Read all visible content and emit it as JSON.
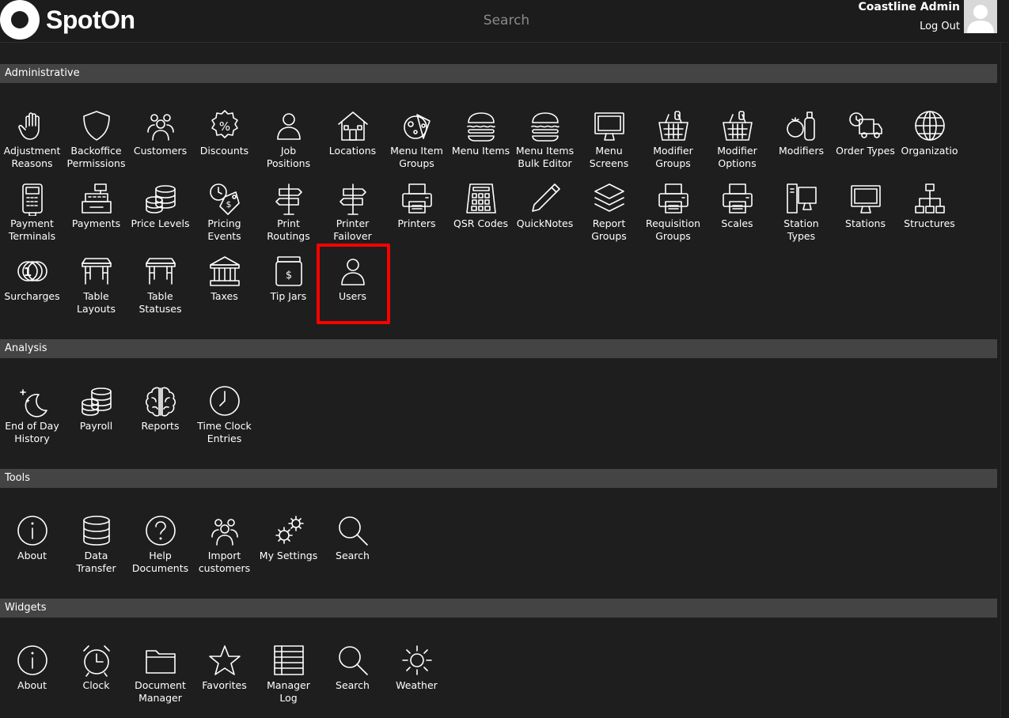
{
  "header": {
    "logo_text": "SpotOn",
    "search_placeholder": "Search",
    "user_name": "Coastline Admin",
    "logout_label": "Log Out"
  },
  "highlight_color": "#ff0000",
  "sections": [
    {
      "title": "Administrative",
      "items": [
        {
          "label": "Adjustment\nReasons",
          "icon": "hand-icon"
        },
        {
          "label": "Backoffice\nPermissions",
          "icon": "shield-icon"
        },
        {
          "label": "Customers",
          "icon": "people-group-icon"
        },
        {
          "label": "Discounts",
          "icon": "percent-badge-icon"
        },
        {
          "label": "Job\nPositions",
          "icon": "person-icon"
        },
        {
          "label": "Locations",
          "icon": "house-icon"
        },
        {
          "label": "Menu Item\nGroups",
          "icon": "food-plate-icon"
        },
        {
          "label": "Menu Items",
          "icon": "burger-icon"
        },
        {
          "label": "Menu Items\nBulk Editor",
          "icon": "burger-icon"
        },
        {
          "label": "Menu\nScreens",
          "icon": "monitor-icon"
        },
        {
          "label": "Modifier\nGroups",
          "icon": "basket-icon"
        },
        {
          "label": "Modifier\nOptions",
          "icon": "basket-icon"
        },
        {
          "label": "Modifiers",
          "icon": "produce-icon"
        },
        {
          "label": "Order Types",
          "icon": "delivery-truck-icon"
        },
        {
          "label": "Organizatio",
          "icon": "globe-icon"
        },
        {
          "label": "Payment\nTerminals",
          "icon": "card-terminal-icon"
        },
        {
          "label": "Payments",
          "icon": "cash-register-icon"
        },
        {
          "label": "Price Levels",
          "icon": "coin-stack-icon"
        },
        {
          "label": "Pricing\nEvents",
          "icon": "price-tag-clock-icon"
        },
        {
          "label": "Print\nRoutings",
          "icon": "signpost-icon"
        },
        {
          "label": "Printer\nFailover",
          "icon": "signpost-icon"
        },
        {
          "label": "Printers",
          "icon": "printer-icon"
        },
        {
          "label": "QSR Codes",
          "icon": "keypad-icon"
        },
        {
          "label": "QuickNotes",
          "icon": "pen-icon"
        },
        {
          "label": "Report\nGroups",
          "icon": "layers-icon"
        },
        {
          "label": "Requisition\nGroups",
          "icon": "printer-icon"
        },
        {
          "label": "Scales",
          "icon": "printer-icon"
        },
        {
          "label": "Station\nTypes",
          "icon": "desktop-tower-icon"
        },
        {
          "label": "Stations",
          "icon": "monitor-icon"
        },
        {
          "label": "Structures",
          "icon": "org-chart-icon"
        },
        {
          "label": "Surcharges",
          "icon": "coins-icon"
        },
        {
          "label": "Table\nLayouts",
          "icon": "table-icon"
        },
        {
          "label": "Table\nStatuses",
          "icon": "table-icon"
        },
        {
          "label": "Taxes",
          "icon": "bank-icon"
        },
        {
          "label": "Tip Jars",
          "icon": "tip-jar-icon"
        },
        {
          "label": "Users",
          "icon": "person-icon"
        }
      ]
    },
    {
      "title": "Analysis",
      "items": [
        {
          "label": "End of Day\nHistory",
          "icon": "moon-icon"
        },
        {
          "label": "Payroll",
          "icon": "coin-stack-icon"
        },
        {
          "label": "Reports",
          "icon": "brain-icon"
        },
        {
          "label": "Time Clock\nEntries",
          "icon": "clock-icon"
        }
      ]
    },
    {
      "title": "Tools",
      "items": [
        {
          "label": "About",
          "icon": "info-icon"
        },
        {
          "label": "Data\nTransfer",
          "icon": "database-icon"
        },
        {
          "label": "Help\nDocuments",
          "icon": "question-icon"
        },
        {
          "label": "Import\ncustomers",
          "icon": "people-group-icon"
        },
        {
          "label": "My Settings",
          "icon": "gears-icon"
        },
        {
          "label": "Search",
          "icon": "magnifier-icon"
        }
      ]
    },
    {
      "title": "Widgets",
      "items": [
        {
          "label": "About",
          "icon": "info-icon"
        },
        {
          "label": "Clock",
          "icon": "alarm-clock-icon"
        },
        {
          "label": "Document\nManager",
          "icon": "folder-icon"
        },
        {
          "label": "Favorites",
          "icon": "star-icon"
        },
        {
          "label": "Manager\nLog",
          "icon": "ledger-icon"
        },
        {
          "label": "Search",
          "icon": "magnifier-icon"
        },
        {
          "label": "Weather",
          "icon": "sun-icon"
        }
      ]
    }
  ]
}
